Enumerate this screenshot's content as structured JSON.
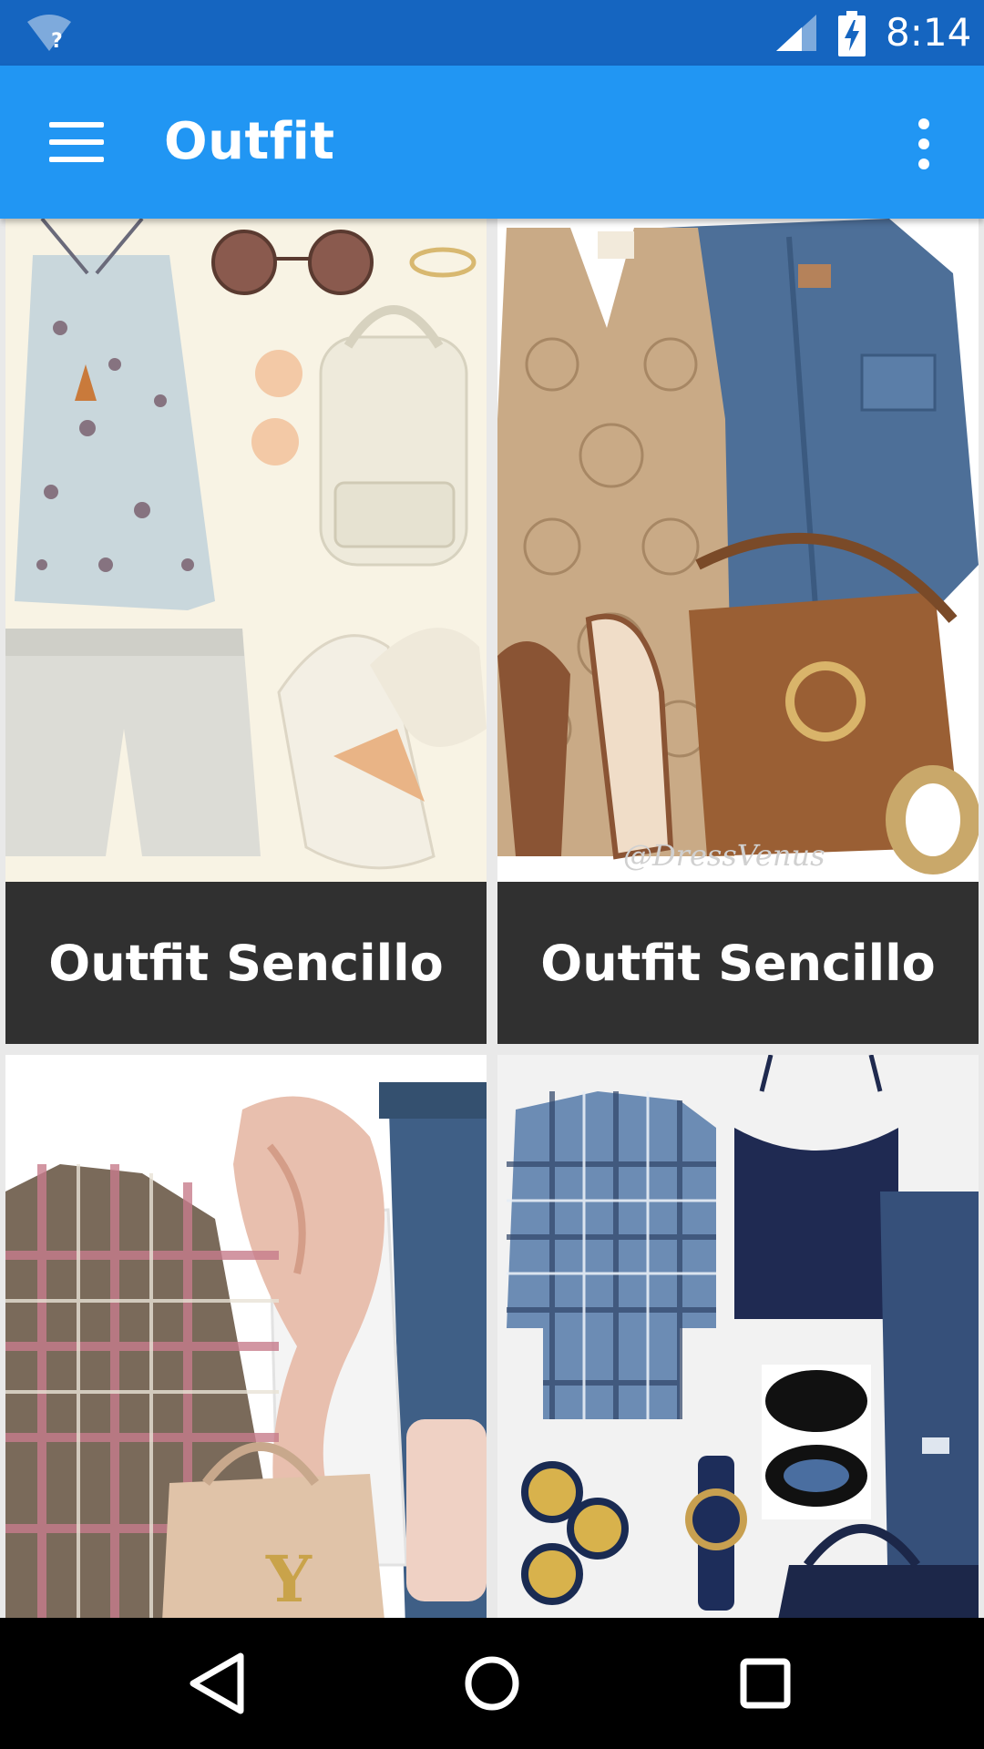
{
  "status_bar": {
    "time": "8:14",
    "wifi_badge": "?",
    "icons": [
      "wifi-unknown-icon",
      "cell-signal-icon",
      "battery-charging-icon"
    ]
  },
  "app_bar": {
    "title": "Outfit",
    "icons": [
      "menu-icon",
      "more-vert-icon"
    ]
  },
  "cards": [
    {
      "caption": "Outfit Sencillo",
      "image": "floral-tank-shorts-sandals-backpack-outfit-photo"
    },
    {
      "caption": "Outfit Sencillo",
      "image": "crochet-dress-denim-jacket-mk-bag-outfit-photo",
      "watermark": "@DressVenus"
    },
    {
      "caption": "",
      "image": "plaid-shirt-scarf-jeans-ysl-bag-outfit-photo"
    },
    {
      "caption": "",
      "image": "blue-plaid-shirt-navy-tank-jeans-watch-outfit-photo"
    }
  ],
  "nav_bar": {
    "icons": [
      "back-icon",
      "home-icon",
      "recents-icon"
    ]
  },
  "colors": {
    "status_bar": "#1565c0",
    "app_bar": "#2196f3",
    "caption_bg": "#303030",
    "nav_bar": "#000000",
    "page_bg": "#e9e9e9"
  }
}
